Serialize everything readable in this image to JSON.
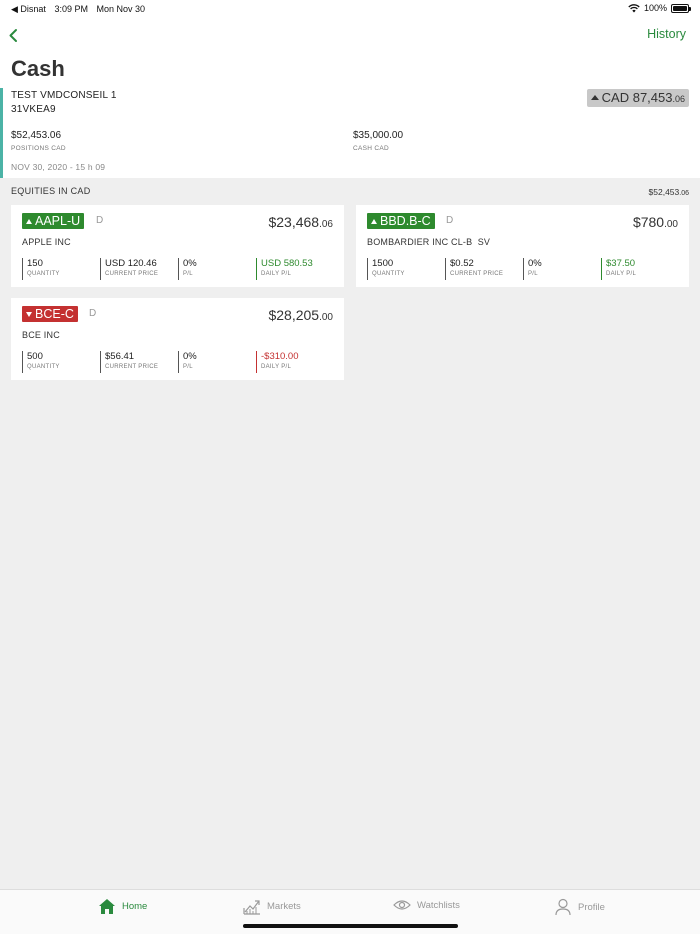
{
  "status_bar": {
    "carrier": "◀ Disnat",
    "time": "3:09 PM",
    "date": "Mon Nov 30",
    "battery": "100%"
  },
  "nav": {
    "history_label": "History"
  },
  "account": {
    "title": "Cash",
    "name": "TEST VMDCONSEIL 1",
    "number": "31VKEA9",
    "total_main": "CAD 87,453",
    "total_cents": ".06",
    "positions_value": "$52,453.06",
    "positions_label": "POSITIONS CAD",
    "cash_value": "$35,000.00",
    "cash_label": "CASH CAD",
    "timestamp": "NOV 30, 2020 - 15 h 09"
  },
  "equities": {
    "heading": "EQUITIES IN CAD",
    "total_main": "$52,453",
    "total_cents": ".06",
    "cards": [
      {
        "symbol": "AAPL-U",
        "direction": "up",
        "flag": "D",
        "value_main": "$23,468",
        "value_cents": ".06",
        "company": "APPLE INC",
        "quantity": "150",
        "quantity_label": "QUANTITY",
        "price": "USD 120.46",
        "price_label": "CURRENT PRICE",
        "pl": "0%",
        "pl_label": "P/L",
        "daily_pl": "USD 580.53",
        "daily_pl_label": "DAILY P/L"
      },
      {
        "symbol": "BBD.B-C",
        "direction": "up",
        "flag": "D",
        "value_main": "$780",
        "value_cents": ".00",
        "company": "BOMBARDIER INC CL-B  SV",
        "quantity": "1500",
        "quantity_label": "QUANTITY",
        "price": "$0.52",
        "price_label": "CURRENT PRICE",
        "pl": "0%",
        "pl_label": "P/L",
        "daily_pl": "$37.50",
        "daily_pl_label": "DAILY P/L"
      },
      {
        "symbol": "BCE-C",
        "direction": "down",
        "flag": "D",
        "value_main": "$28,205",
        "value_cents": ".00",
        "company": "BCE INC",
        "quantity": "500",
        "quantity_label": "QUANTITY",
        "price": "$56.41",
        "price_label": "CURRENT PRICE",
        "pl": "0%",
        "pl_label": "P/L",
        "daily_pl": "-$310.00",
        "daily_pl_label": "DAILY P/L"
      }
    ]
  },
  "tabs": [
    {
      "label": "Home",
      "icon": "home-icon",
      "active": true
    },
    {
      "label": "Markets",
      "icon": "chart-icon",
      "active": false
    },
    {
      "label": "Watchlists",
      "icon": "eye-icon",
      "active": false
    },
    {
      "label": "Profile",
      "icon": "person-icon",
      "active": false
    }
  ],
  "colors": {
    "accent_green": "#2a8a3e",
    "up_green": "#2e8a2e",
    "down_red": "#c43131",
    "account_bar": "#4bb3a6"
  }
}
